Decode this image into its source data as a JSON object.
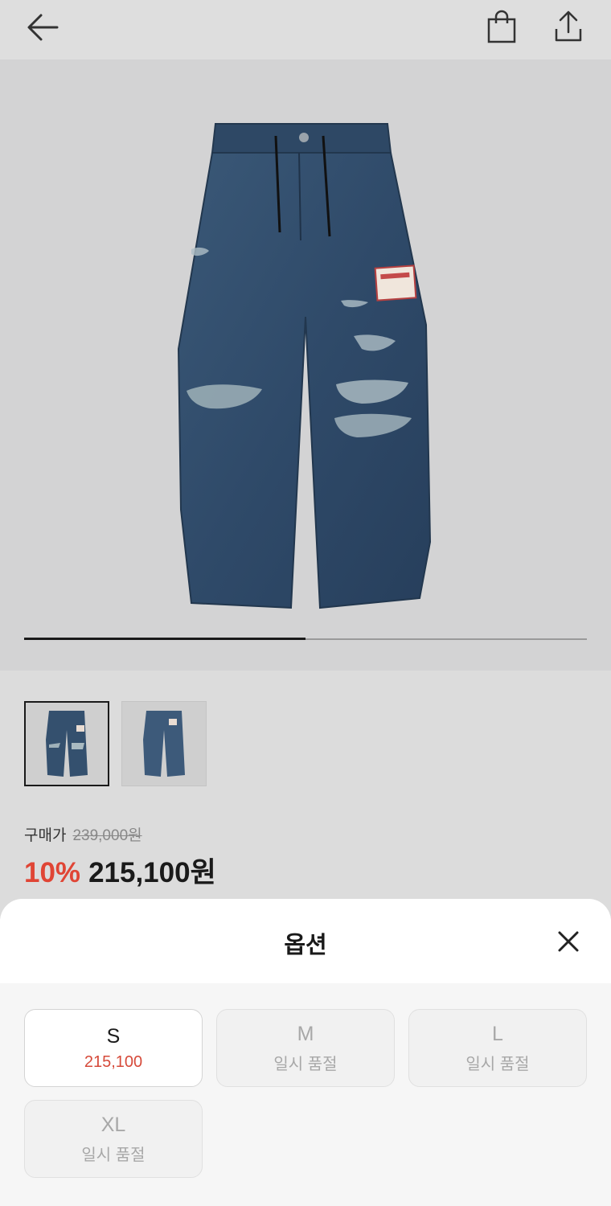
{
  "header": {
    "back_icon": "arrow-left-icon",
    "bag_icon": "shopping-bag-icon",
    "share_icon": "share-icon"
  },
  "gallery": {
    "image_subject": "distressed wide-leg denim jeans",
    "progress_fraction": 0.5,
    "thumbnails": [
      "front view",
      "back view"
    ]
  },
  "price": {
    "label": "구매가",
    "original": "239,000원",
    "discount": "10%",
    "final": "215,100원",
    "discount_color": "#e04535"
  },
  "options_sheet": {
    "title": "옵션",
    "close_icon": "close-icon",
    "options": [
      {
        "size": "S",
        "sub": "215,100",
        "status": "available"
      },
      {
        "size": "M",
        "sub": "일시 품절",
        "status": "soldout"
      },
      {
        "size": "L",
        "sub": "일시 품절",
        "status": "soldout"
      },
      {
        "size": "XL",
        "sub": "일시 품절",
        "status": "soldout"
      }
    ]
  }
}
